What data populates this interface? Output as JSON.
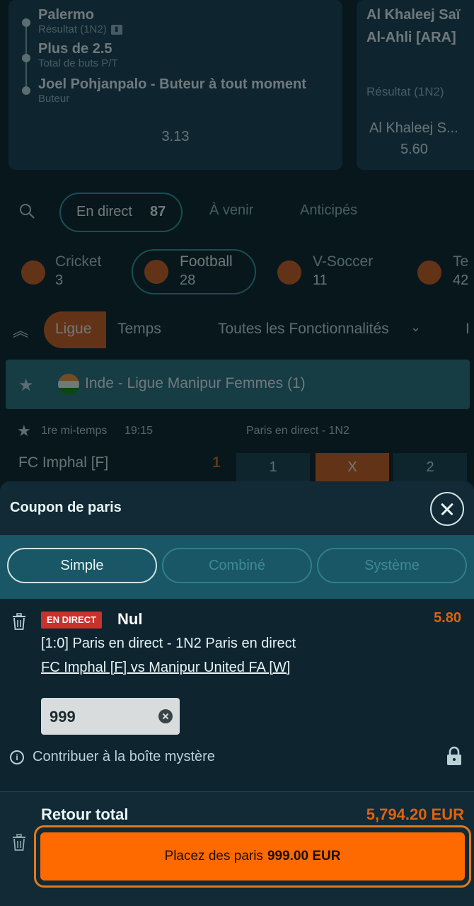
{
  "background": {
    "card1": {
      "legs": [
        {
          "title": "Palermo",
          "sub": "Résultat (1N2)"
        },
        {
          "title": "Plus de  2.5",
          "sub": "Total de buts P/T"
        },
        {
          "title": "Joel Pohjanpalo - Buteur à tout moment",
          "sub": "Buteur"
        }
      ],
      "odds": "3.13"
    },
    "card2": {
      "team1": "Al Khaleej Saï",
      "team2": "Al-Ahli [ARA]",
      "market": "Résultat (1N2)",
      "selection": "Al Khaleej S...",
      "odds": "5.60"
    },
    "filters": {
      "live_label": "En direct",
      "live_count": "87",
      "upcoming": "À venir",
      "anticipated": "Anticipés"
    },
    "sports": [
      {
        "name": "Cricket",
        "count": "3"
      },
      {
        "name": "Football",
        "count": "28"
      },
      {
        "name": "V-Soccer",
        "count": "11"
      },
      {
        "name": "Te",
        "count": "42"
      }
    ],
    "tabs": {
      "league": "Ligue",
      "time": "Temps",
      "features": "Toutes les Fonctionnalités",
      "extra": "I"
    },
    "league": {
      "name": "Inde - Ligue Manipur Femmes (1)"
    },
    "match": {
      "period": "1re mi-temps",
      "clock": "19:15",
      "market_header": "Paris en direct - 1N2",
      "team": "FC Imphal [F]",
      "score": "1",
      "odds_labels": [
        "1",
        "X",
        "2"
      ]
    }
  },
  "betslip": {
    "title": "Coupon de paris",
    "modes": [
      "Simple",
      "Combiné",
      "Système"
    ],
    "bet": {
      "live_badge": "EN DIRECT",
      "selection": "Nul",
      "odds": "5.80",
      "market": "[1:0] Paris en direct - 1N2 Paris en direct",
      "event": "FC Imphal [F] vs Manipur United FA [W]",
      "stake": "999"
    },
    "mystery_box": "Contribuer à la boîte mystère",
    "total_label": "Retour total",
    "total_value": "5,794.20 EUR",
    "place_label": "Placez des paris",
    "place_amount": "999.00 EUR"
  },
  "colors": {
    "accent": "#ff6a00",
    "odds_orange": "#e0620f",
    "live_red": "#c9322b",
    "teal": "#1a5766"
  }
}
